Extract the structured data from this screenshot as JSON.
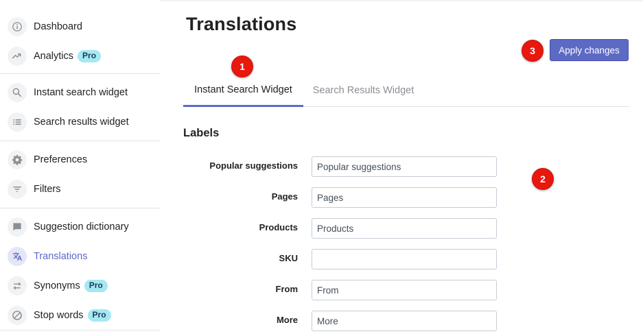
{
  "sidebar": {
    "items": [
      {
        "label": "Dashboard",
        "icon": "info-icon"
      },
      {
        "label": "Analytics",
        "icon": "trend-icon",
        "badge": "Pro"
      },
      {
        "label": "Instant search widget",
        "icon": "search-icon"
      },
      {
        "label": "Search results widget",
        "icon": "list-icon"
      },
      {
        "label": "Preferences",
        "icon": "gear-icon"
      },
      {
        "label": "Filters",
        "icon": "filter-icon"
      },
      {
        "label": "Suggestion dictionary",
        "icon": "chat-icon"
      },
      {
        "label": "Translations",
        "icon": "translate-icon",
        "active": true
      },
      {
        "label": "Synonyms",
        "icon": "swap-icon",
        "badge": "Pro"
      },
      {
        "label": "Stop words",
        "icon": "block-icon",
        "badge": "Pro"
      }
    ]
  },
  "header": {
    "title": "Translations",
    "apply_label": "Apply changes"
  },
  "tabs": [
    {
      "label": "Instant Search Widget",
      "selected": true
    },
    {
      "label": "Search Results Widget",
      "selected": false
    }
  ],
  "section": {
    "title": "Labels"
  },
  "fields": [
    {
      "label": "Popular suggestions",
      "value": "Popular suggestions"
    },
    {
      "label": "Pages",
      "value": "Pages"
    },
    {
      "label": "Products",
      "value": "Products"
    },
    {
      "label": "SKU",
      "value": ""
    },
    {
      "label": "From",
      "value": "From"
    },
    {
      "label": "More",
      "value": "More"
    }
  ],
  "markers": [
    "1",
    "2",
    "3"
  ],
  "colors": {
    "accent": "#5c6ac4",
    "badge_bg": "#a4e8f2",
    "marker_red": "#e8180e"
  }
}
